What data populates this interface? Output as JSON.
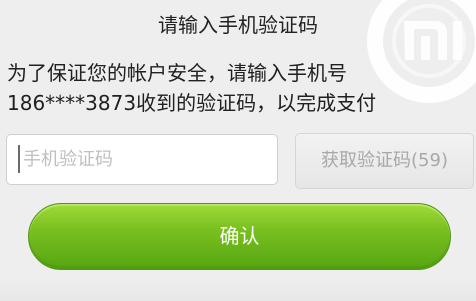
{
  "dialog": {
    "title": "请输入手机验证码",
    "instruction_line_1": "为了保证您的帐户安全，请输入手机号",
    "instruction_line_2": "186****3873收到的验证码，以完成支付"
  },
  "code_input": {
    "value": "",
    "placeholder": "手机验证码"
  },
  "buttons": {
    "resend_label": "获取验证码(59)",
    "confirm_label": "确认"
  },
  "colors": {
    "background": "#eeeeee",
    "primary_green": "#6fbe1f",
    "disabled_text": "#a8a8a8",
    "text": "#222222"
  },
  "icons": {
    "watermark": "mi-logo-watermark-icon"
  }
}
